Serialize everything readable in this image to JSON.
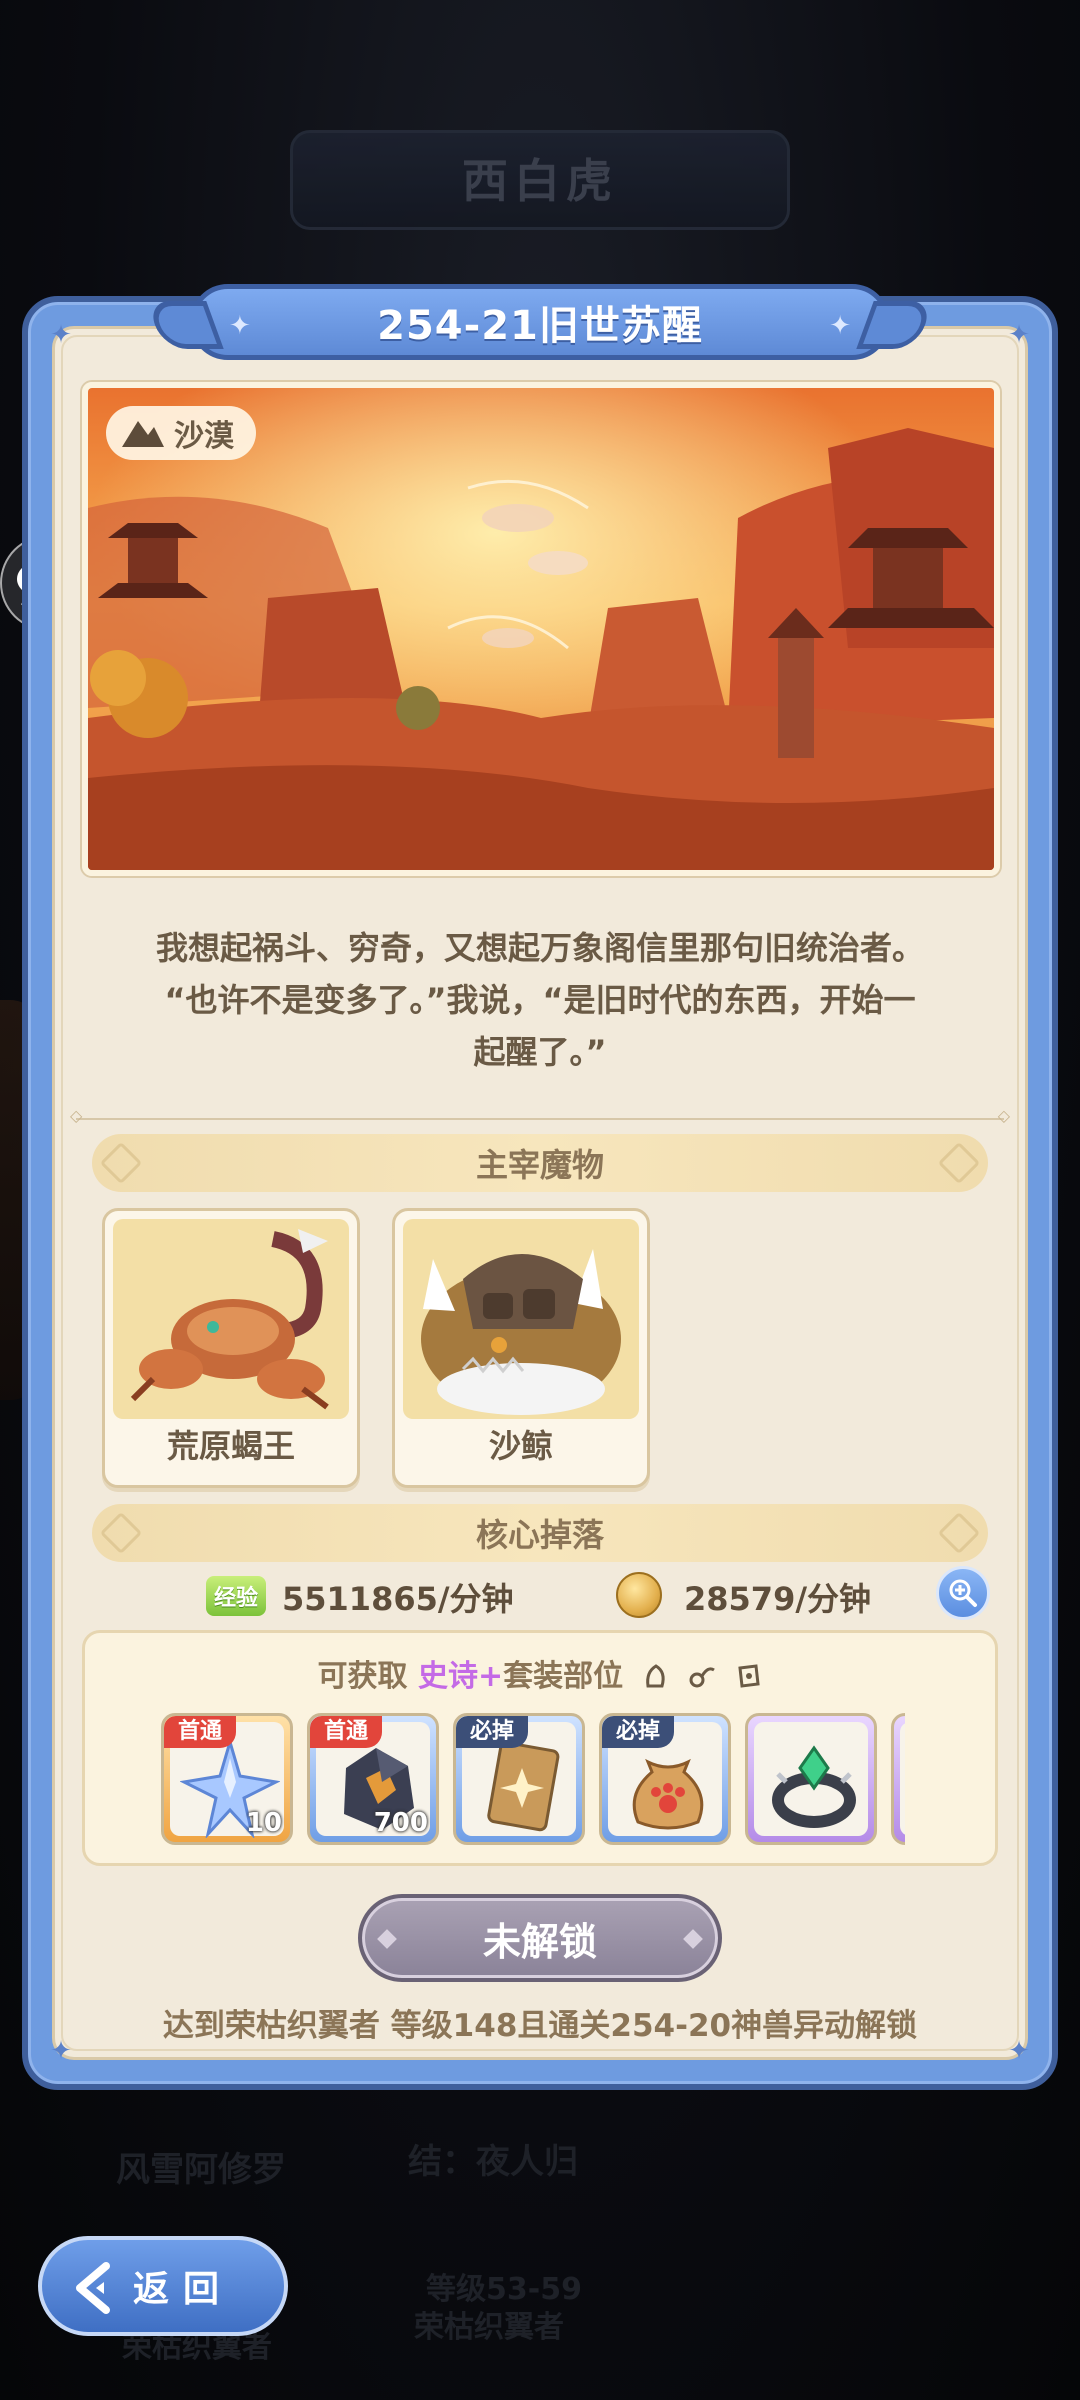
{
  "background": {
    "region_title": "西白虎",
    "bottom_labels": [
      "风雪阿修罗",
      "结：夜人归",
      "等级53-59",
      "荣枯织翼者",
      "荣枯织翼者"
    ]
  },
  "stage": {
    "title": "254-21旧世苏醒",
    "terrain": "沙漠",
    "description_lines": [
      "我想起祸斗、穷奇，又想起万象阁信里那句旧统治者。",
      "“也许不是变多了。”我说，“是旧时代的东西，开始一",
      "起醒了。”"
    ]
  },
  "bosses": {
    "header": "主宰魔物",
    "items": [
      {
        "name": "荒原蝎王"
      },
      {
        "name": "沙鲸"
      }
    ]
  },
  "drops": {
    "header": "核心掉落",
    "exp_icon_label": "经验",
    "exp_rate": "5511865/分钟",
    "coin_rate": "28579/分钟",
    "loot_title_prefix": "可获取",
    "loot_title_epic": "史诗+",
    "loot_title_suffix": "套装部位",
    "items": [
      {
        "tag": "首通",
        "qty": "10",
        "icon": "crystal-star-icon",
        "rarity": "orange"
      },
      {
        "tag": "首通",
        "qty": "700",
        "icon": "ore-icon",
        "rarity": "blue"
      },
      {
        "tag": "必掉",
        "qty": "",
        "icon": "card-icon",
        "rarity": "blue"
      },
      {
        "tag": "必掉",
        "qty": "",
        "icon": "paw-bag-icon",
        "rarity": "blue"
      },
      {
        "tag": "",
        "qty": "",
        "icon": "gem-ring-icon",
        "rarity": "purple"
      },
      {
        "tag": "",
        "qty": "",
        "icon": "partial-item-icon",
        "rarity": "purple"
      }
    ]
  },
  "action": {
    "button_label": "未解锁",
    "requirement": "达到荣枯织翼者 等级148且通关254-20神兽异动解锁"
  },
  "nav": {
    "back_label": "返回"
  },
  "colors": {
    "panel_blue": "#6e9be0",
    "parchment": "#f2eadb",
    "epic_purple": "#c46ae6",
    "tag_red": "#e2453b",
    "tag_navy": "#3c4f78"
  }
}
